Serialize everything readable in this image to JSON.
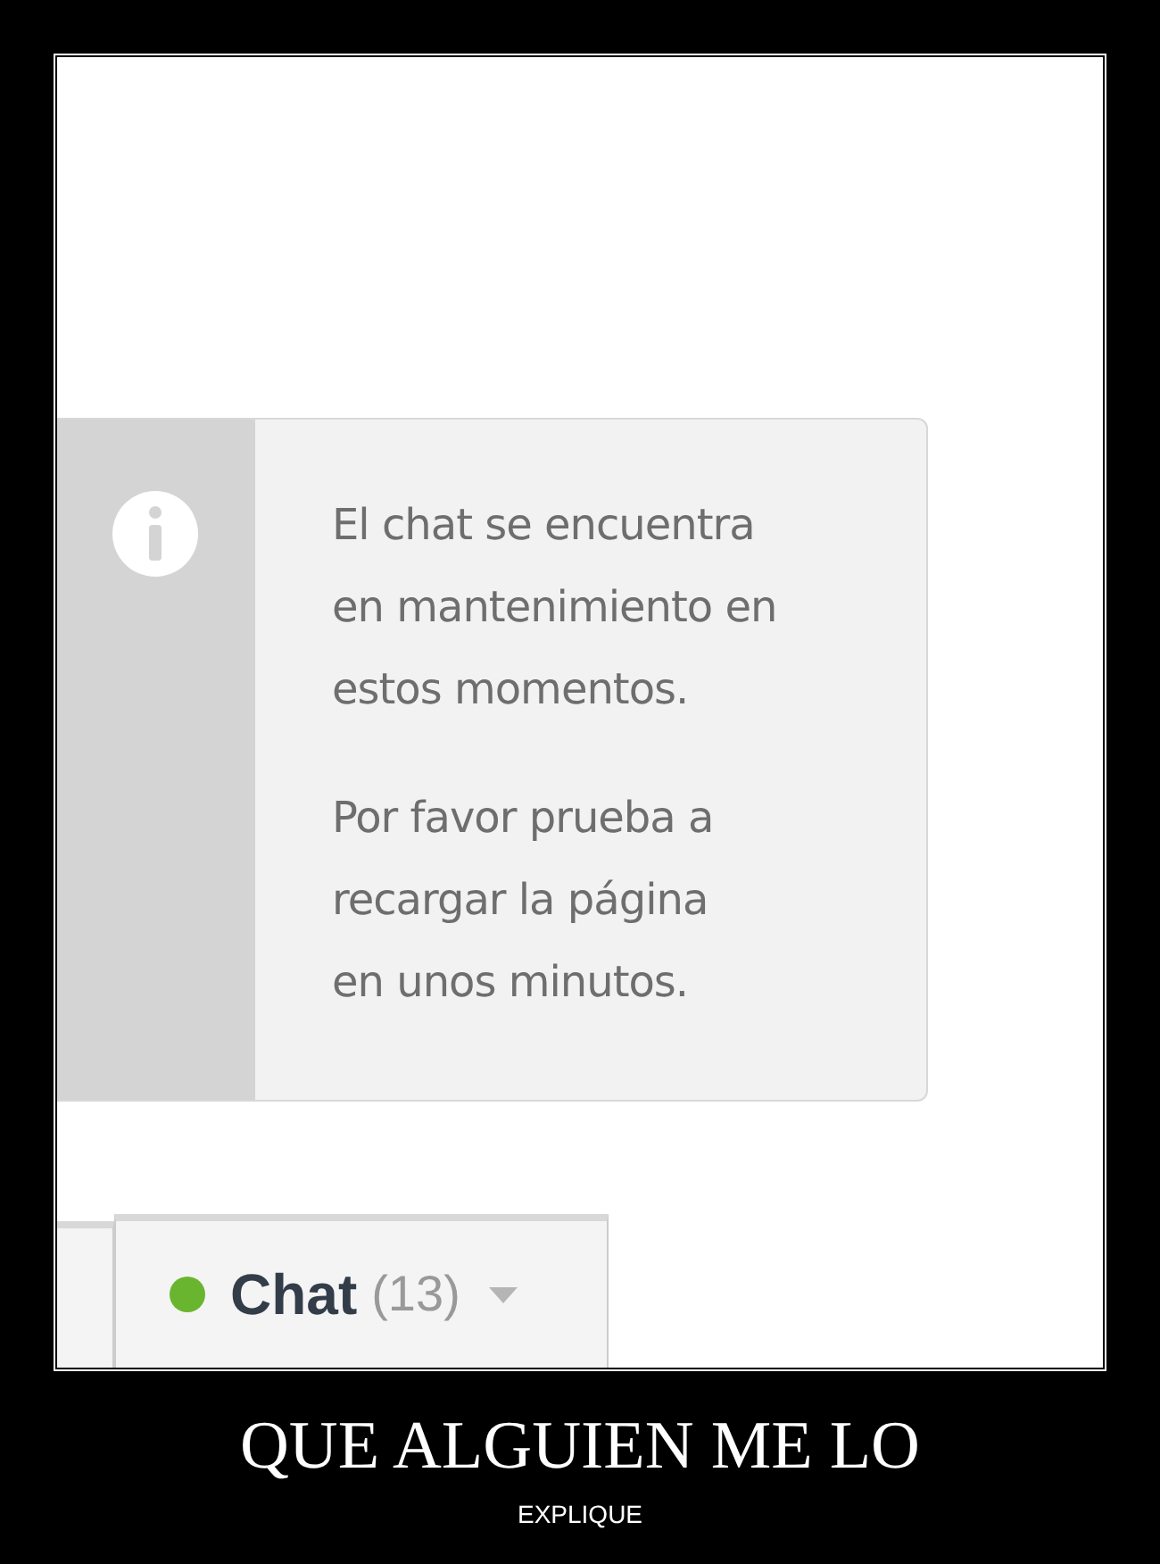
{
  "notice": {
    "paragraphs": [
      [
        "El chat se encuentra",
        "en mantenimiento en",
        "estos momentos."
      ],
      [
        "Por favor prueba a",
        "recargar la página",
        "en unos minutos."
      ]
    ]
  },
  "chat_tab": {
    "label": "Chat",
    "count": "(13)",
    "status": {
      "color": "#6ab52f"
    }
  },
  "caption": {
    "title": "QUE ALGUIEN ME LO",
    "subtitle": "EXPLIQUE"
  }
}
